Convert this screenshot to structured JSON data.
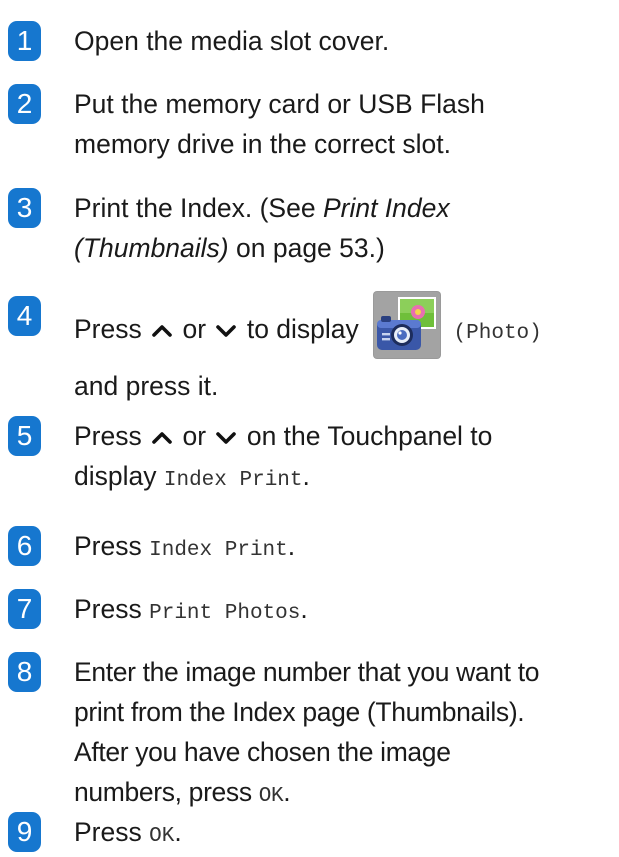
{
  "steps": [
    {
      "num": "1",
      "text": "Open the media slot cover."
    },
    {
      "num": "2",
      "line1": "Put the memory card or USB Flash",
      "line2": "memory drive in the correct slot."
    },
    {
      "num": "3",
      "pre": "Print the Index. (See ",
      "italic1": "Print Index",
      "italic2": "(Thumbnails)",
      "post": " on page 53.)"
    },
    {
      "num": "4",
      "press": "Press",
      "or": "or",
      "display": "to display",
      "photo": "(Photo)",
      "line2": "and press it."
    },
    {
      "num": "5",
      "press": "Press",
      "or": "or",
      "rest": "on the Touchpanel to",
      "display": "display",
      "mono": "Index Print",
      "dot": "."
    },
    {
      "num": "6",
      "press": "Press",
      "mono": "Index Print",
      "dot": "."
    },
    {
      "num": "7",
      "press": "Press",
      "mono": "Print Photos",
      "dot": "."
    },
    {
      "num": "8",
      "line1": "Enter the image number that you want to",
      "line2": "print from the Index page (Thumbnails).",
      "line3": "After you have chosen the image",
      "line4pre": "numbers, press",
      "mono": "OK",
      "dot": "."
    },
    {
      "num": "9",
      "press": "Press",
      "mono": "OK",
      "dot": "."
    }
  ],
  "icons": {
    "up": "chevron-up-icon",
    "down": "chevron-down-icon",
    "photo": "photo-camera-icon"
  },
  "colors": {
    "badge": "#1677cf"
  }
}
